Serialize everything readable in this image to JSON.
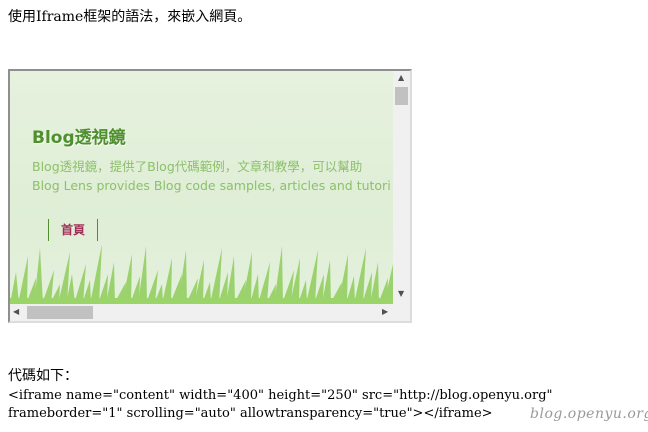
{
  "intro_text": "使用Iframe框架的語法，來嵌入網頁。",
  "embedded": {
    "title": "Blog透視鏡",
    "description_line1": "Blog透視鏡，提供了Blog代碼範例，文章和教學，可以幫助",
    "description_line2": "Blog Lens provides Blog code samples, articles and tutori",
    "nav": [
      {
        "label": "首頁"
      }
    ]
  },
  "scrollbars": {
    "vertical": {
      "up_icon": "▲",
      "down_icon": "▼"
    },
    "horizontal": {
      "left_icon": "◀",
      "right_icon": "▶"
    }
  },
  "code": {
    "label": "代碼如下：",
    "line1": "<iframe name=\"content\" width=\"400\" height=\"250\" src=\"http://blog.openyu.org\"",
    "line2": "frameborder=\"1\" scrolling=\"auto\" allowtransparency=\"true\"></iframe>"
  },
  "watermark": "blog.openyu.org",
  "colors": {
    "title_green": "#4e8f2e",
    "desc_green": "#8cc06a",
    "nav_pink": "#a0305a",
    "grass": "#8fcd5c"
  }
}
